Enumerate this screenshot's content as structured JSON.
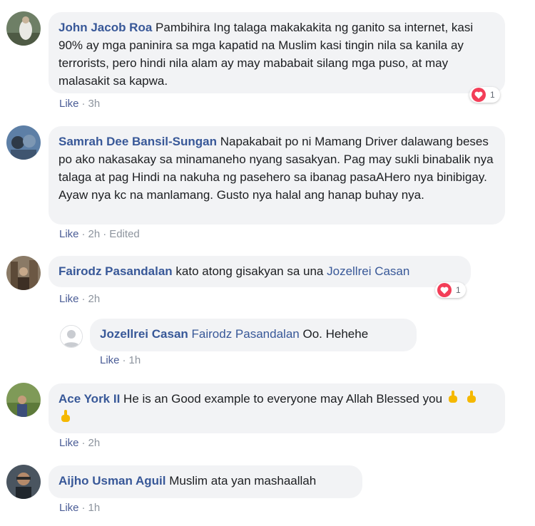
{
  "comments": [
    {
      "author": "John Jacob Roa",
      "text": "Pambihira Ing talaga makakakita ng ganito sa internet, kasi 90% ay mga paninira sa mga kapatid na Muslim kasi tingin nila sa kanila ay terrorists, pero hindi nila alam ay may mababait silang mga puso, at may malasakit sa kapwa.",
      "like": "Like",
      "time": "3h",
      "reactions": "1"
    },
    {
      "author": "Samrah Dee Bansil-Sungan",
      "text": "Napakabait po ni Mamang Driver dalawang beses po ako nakasakay sa minamaneho nyang sasakyan. Pag may sukli binabalik nya talaga at pag Hindi na nakuha ng pasehero sa ibanag pasaAHero nya binibigay. Ayaw nya kc na manlamang. Gusto nya halal ang hanap buhay nya.",
      "like": "Like",
      "time": "2h",
      "edited": "Edited"
    },
    {
      "author": "Fairodz Pasandalan",
      "text": "kato atong gisakyan sa una",
      "mention": "Jozellrei Casan",
      "like": "Like",
      "time": "2h",
      "reactions": "1"
    },
    {
      "author": "Jozellrei Casan",
      "mention": "Fairodz Pasandalan",
      "text": "Oo. Hehehe",
      "like": "Like",
      "time": "1h"
    },
    {
      "author": "Ace York II",
      "text": "He is an Good example to everyone may Allah Blessed you",
      "like": "Like",
      "time": "2h"
    },
    {
      "author": "Aijho Usman Aguil",
      "text": "Muslim ata yan mashaallah",
      "like": "Like",
      "time": "1h"
    }
  ],
  "icons": {
    "reaction": "heart-love-icon",
    "emoji": "pointing-up-hand-emoji",
    "default_avatar": "default-user-silhouette-icon"
  },
  "colors": {
    "name": "#385898",
    "bubble": "#f2f3f5",
    "meta": "#8d949e",
    "heart": "#f33e58"
  }
}
